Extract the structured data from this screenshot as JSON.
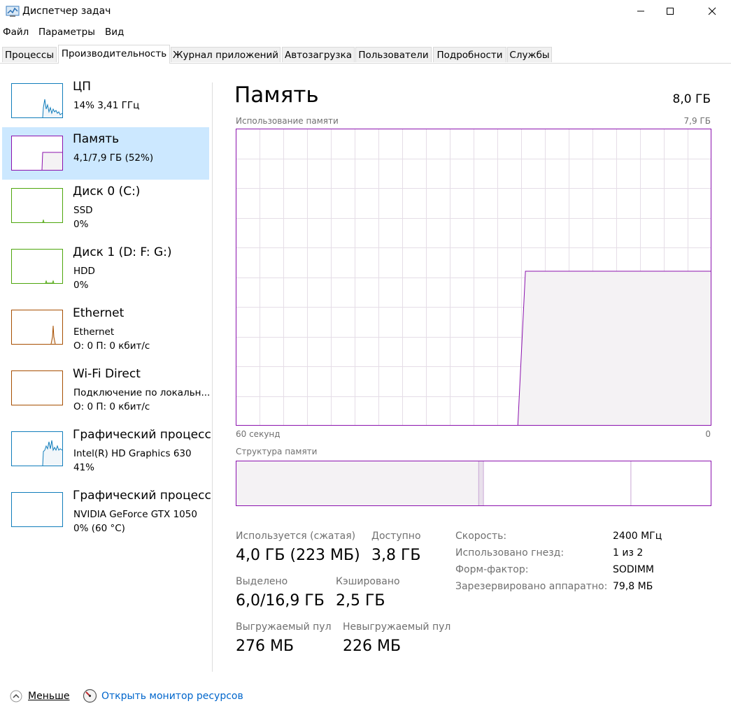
{
  "window": {
    "title": "Диспетчер задач",
    "accent": "#8b12ae"
  },
  "menu": {
    "file": "Файл",
    "params": "Параметры",
    "view": "Вид"
  },
  "tabs": [
    {
      "label": "Процессы",
      "active": false
    },
    {
      "label": "Производительность",
      "active": true
    },
    {
      "label": "Журнал приложений",
      "active": false
    },
    {
      "label": "Автозагрузка",
      "active": false
    },
    {
      "label": "Пользователи",
      "active": false
    },
    {
      "label": "Подробности",
      "active": false
    },
    {
      "label": "Службы",
      "active": false
    }
  ],
  "sidebar": {
    "items": [
      {
        "title": "ЦП",
        "line1": "14%  3,41 ГГц",
        "line2": "",
        "color": "#117dbb",
        "icon": "cpu-graph"
      },
      {
        "title": "Память",
        "line1": "4,1/7,9 ГБ (52%)",
        "line2": "",
        "color": "#8b12ae",
        "icon": "memory-graph",
        "selected": true
      },
      {
        "title": "Диск 0 (C:)",
        "line1": "SSD",
        "line2": "0%",
        "color": "#4da60c",
        "icon": "disk-graph"
      },
      {
        "title": "Диск 1 (D: F: G:)",
        "line1": "HDD",
        "line2": "0%",
        "color": "#4da60c",
        "icon": "disk-graph"
      },
      {
        "title": "Ethernet",
        "line1": "Ethernet",
        "line2": "О: 0 П: 0 кбит/с",
        "color": "#a74f01",
        "icon": "ethernet-graph"
      },
      {
        "title": "Wi-Fi Direct",
        "line1": "Подключение по локальн...",
        "line2": "О: 0 П: 0 кбит/с",
        "color": "#a74f01",
        "icon": "wifi-graph"
      },
      {
        "title": "Графический процесс",
        "line1": "Intel(R) HD Graphics 630",
        "line2": "41%",
        "color": "#117dbb",
        "icon": "gpu-graph"
      },
      {
        "title": "Графический процесс",
        "line1": "NVIDIA GeForce GTX 1050",
        "line2": "0% (60 °C)",
        "color": "#117dbb",
        "icon": "gpu-graph"
      }
    ]
  },
  "main": {
    "title": "Память",
    "total": "8,0 ГБ",
    "usage_label": "Использование памяти",
    "usage_max": "7,9 ГБ",
    "time_left": "60 секунд",
    "time_right": "0",
    "composition_label": "Структура памяти",
    "usage_graph_level": 0.52,
    "composition": {
      "in_use": 0.51,
      "modified": 0.01,
      "standby": 0.31,
      "free": 0.17
    },
    "stats": {
      "in_use_label": "Используется (сжатая)",
      "in_use_value": "4,0 ГБ (223 МБ)",
      "available_label": "Доступно",
      "available_value": "3,8 ГБ",
      "committed_label": "Выделено",
      "committed_value": "6,0/16,9 ГБ",
      "cached_label": "Кэшировано",
      "cached_value": "2,5 ГБ",
      "paged_label": "Выгружаемый пул",
      "paged_value": "276 МБ",
      "nonpaged_label": "Невыгружаемый пул",
      "nonpaged_value": "226 МБ"
    },
    "specs": [
      {
        "label": "Скорость:",
        "value": "2400 МГц"
      },
      {
        "label": "Использовано гнезд:",
        "value": "1 из 2"
      },
      {
        "label": "Форм-фактор:",
        "value": "SODIMM"
      },
      {
        "label": "Зарезервировано аппаратно:",
        "value": "79,8 МБ"
      }
    ]
  },
  "footer": {
    "less_label": "Меньше",
    "monitor_link": "Открыть монитор ресурсов"
  }
}
